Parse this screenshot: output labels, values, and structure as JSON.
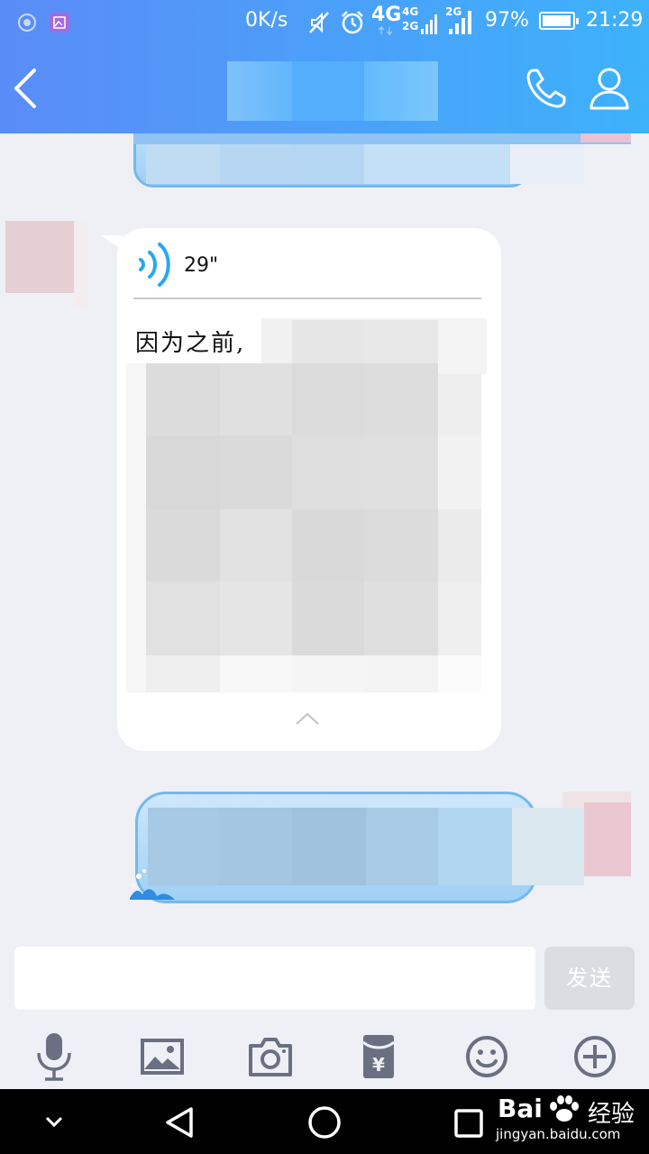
{
  "status_bar": {
    "net_speed": "0K/s",
    "network_4g": "4G",
    "network_4g_small": "4G",
    "network_2g_small": "2G",
    "network_2g": "2G",
    "battery_percent": "97%",
    "battery_level": 0.97,
    "time": "21:29"
  },
  "header": {
    "chat_title": "",
    "back_icon": "back-chevron-icon",
    "call_icon": "phone-icon",
    "profile_icon": "user-icon"
  },
  "messages": {
    "voice_message": {
      "duration": "29\"",
      "transcript": "因为之前,"
    }
  },
  "input": {
    "value": "",
    "placeholder": "",
    "send_label": "发送"
  },
  "toolbar": {
    "items": [
      "mic-icon",
      "image-icon",
      "camera-icon",
      "red-packet-icon",
      "emoji-icon",
      "plus-icon"
    ]
  },
  "watermark": {
    "logo": "Bai",
    "logo_suffix": "经验",
    "url": "jingyan.baidu.com"
  },
  "colors": {
    "header_start": "#5a8cf7",
    "header_end": "#3db2fb",
    "background": "#eef0f6",
    "bubble_blue": "#9fd0f6",
    "send_disabled": "#dcdde2"
  }
}
